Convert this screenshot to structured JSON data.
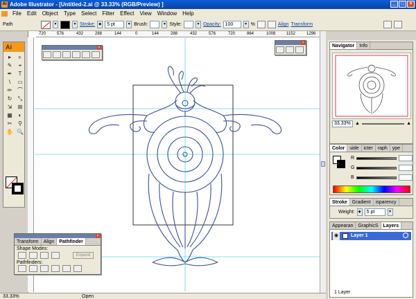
{
  "window": {
    "title": "Adobe Illustrator - [Untitled-2.ai @ 33.33% (RGB/Preview) ]",
    "app_icon": "Ai",
    "controls": [
      "_",
      "□",
      "×"
    ]
  },
  "menu": [
    "File",
    "Edit",
    "Object",
    "Type",
    "Select",
    "Filter",
    "Effect",
    "View",
    "Window",
    "Help"
  ],
  "control_bar": {
    "selection_label": "Path",
    "stroke_label": "Stroke:",
    "stroke_value": "5 pt",
    "brush_label": "Brush:",
    "style_label": "Style:",
    "opacity_label": "Opacity:",
    "opacity_value": "100",
    "opacity_unit": "%",
    "align_label": "Align",
    "transform_label": "Transform"
  },
  "ruler_ticks": [
    "720",
    "576",
    "432",
    "288",
    "144",
    "0",
    "144",
    "288",
    "432",
    "576",
    "720",
    "864",
    "1008",
    "1152",
    "1296"
  ],
  "toolbox": {
    "logo": "Ai",
    "tools": [
      "▸",
      "▹",
      "✎",
      "⌖",
      "✒",
      "T",
      "\\",
      "▭",
      "✏",
      "⌒",
      "↻",
      "⤡",
      "⇲",
      "⊞",
      "▦",
      "◐",
      "✂",
      "⚲",
      "✋",
      "🔍"
    ]
  },
  "status": {
    "zoom": "33.33%",
    "text": "Open"
  },
  "navigator": {
    "tabs": [
      "Navigator",
      "Info"
    ],
    "zoom": "33.33%"
  },
  "color_panel": {
    "tabs": [
      "Color",
      "uide",
      "icter",
      "raph",
      "ype"
    ],
    "channels": [
      "R",
      "G",
      "B"
    ]
  },
  "stroke_panel": {
    "tabs": [
      "Stroke",
      "Gradient",
      "isparency"
    ],
    "weight_label": "Weight:",
    "weight_value": "5 pt"
  },
  "layers_panel": {
    "tabs": [
      "Appearan",
      "GraphicS",
      "Layers"
    ],
    "layer_name": "Layer 1",
    "footer": "1 Layer"
  },
  "pathfinder": {
    "tabs": [
      "Transform",
      "Align",
      "Pathfinder"
    ],
    "shape_modes_label": "Shape Modes:",
    "expand_label": "Expand",
    "pathfinders_label": "Pathfinders:"
  },
  "colors": {
    "artwork_stroke": "#3a4f9a",
    "guide": "#5ad6e8",
    "selection": "#2a6ad8"
  }
}
